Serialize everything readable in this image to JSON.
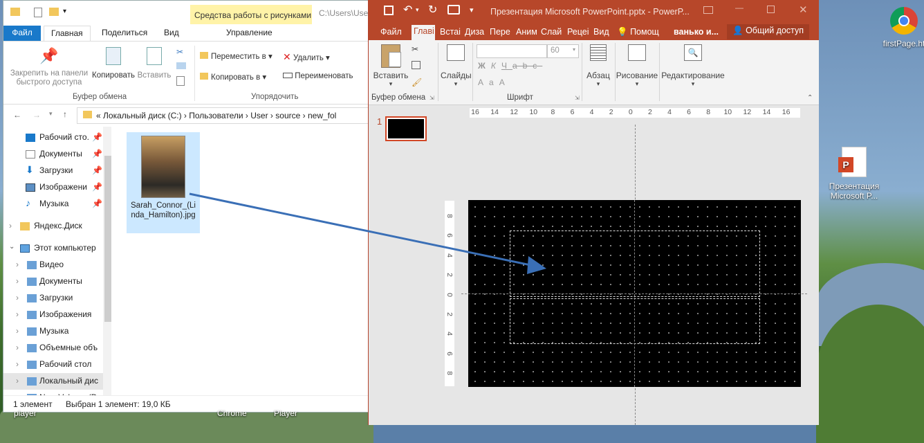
{
  "explorer": {
    "contextual_tab": "Средства работы с рисунками",
    "path_preview": "C:\\Users\\User",
    "tabs": [
      "Файл",
      "Главная",
      "Поделиться",
      "Вид",
      "Управление"
    ],
    "ribbon": {
      "pin_label": "Закрепить на панели быстрого доступа",
      "copy_label": "Копировать",
      "paste_label": "Вставить",
      "move_label": "Переместить в",
      "copyto_label": "Копировать в",
      "delete_label": "Удалить",
      "rename_label": "Переименовать",
      "group_clipboard": "Буфер обмена",
      "group_organize": "Упорядочить"
    },
    "address": [
      "Локальный диск (C:)",
      "Пользователи",
      "User",
      "source",
      "new_fol"
    ],
    "nav_quick": [
      "Рабочий сто.",
      "Документы",
      "Загрузки",
      "Изображени",
      "Музыка"
    ],
    "nav_other": [
      "Яндекс.Диск",
      "Этот компьютер"
    ],
    "nav_pc": [
      "Видео",
      "Документы",
      "Загрузки",
      "Изображения",
      "Музыка",
      "Объемные объ",
      "Рабочий стол",
      "Локальный дис",
      "New Volume (D"
    ],
    "file_name": "Sarah_Connor_(Linda_Hamilton).jpg",
    "status_count": "1 элемент",
    "status_selected": "Выбран 1 элемент: 19,0 КБ"
  },
  "ppt": {
    "title": "Презентация Microsoft PowerPoint.pptx - PowerP...",
    "tabs": [
      "Файл",
      "Главі",
      "Встаі",
      "Диза",
      "Пере",
      "Аним",
      "Слай",
      "Рецеі",
      "Вид",
      "Помощ",
      "ванько и...",
      "Общий доступ"
    ],
    "paste": "Вставить",
    "clipboard_group": "Буфер обмена",
    "slides_btn": "Слайды",
    "font_group": "Шрифт",
    "font_size": "60",
    "paragraph": "Абзац",
    "drawing": "Рисование",
    "editing": "Редактирование",
    "slide_number": "1",
    "hruler": [
      "16",
      "14",
      "12",
      "10",
      "8",
      "6",
      "4",
      "2",
      "0",
      "2",
      "4",
      "6",
      "8",
      "10",
      "12",
      "14",
      "16"
    ],
    "vruler": [
      "8",
      "6",
      "4",
      "2",
      "0",
      "2",
      "4",
      "6",
      "8"
    ]
  },
  "desktop": {
    "chrome_label": "firstPage.ht",
    "pptx_label": "Презентация Microsoft P...",
    "taskbar_labels": [
      "player",
      "Chrome",
      "Player"
    ]
  },
  "colors": {
    "ppt_accent": "#b7472a",
    "explorer_accent": "#1979ca"
  }
}
